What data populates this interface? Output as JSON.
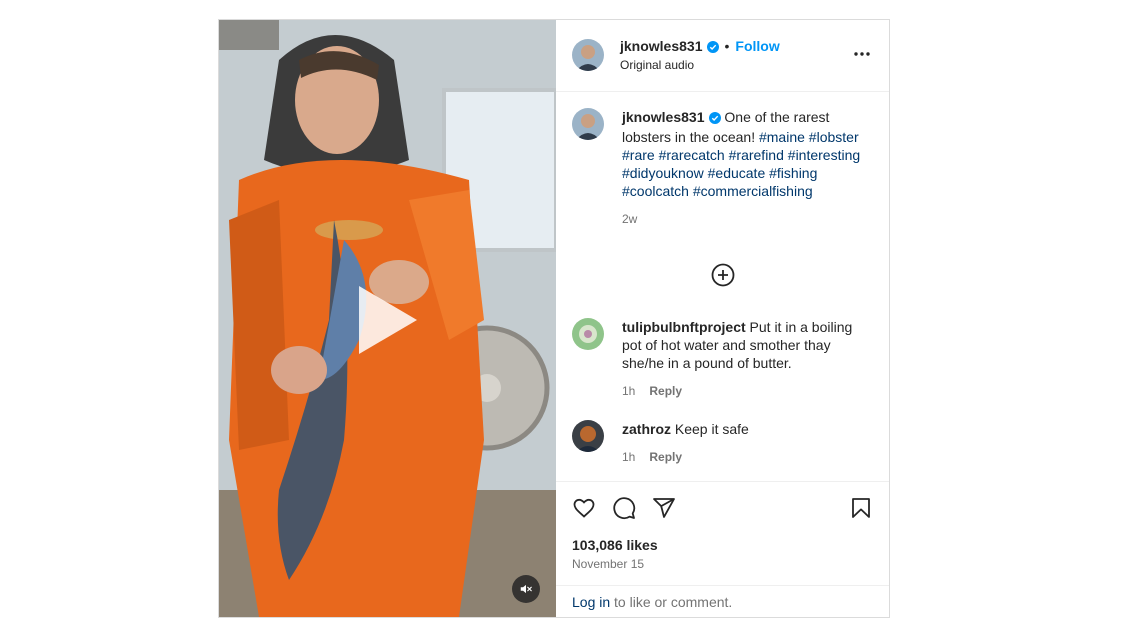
{
  "post": {
    "author": "jknowles831",
    "follow_label": "Follow",
    "separator": "•",
    "audio": "Original audio",
    "caption": {
      "text": "One of the rarest lobsters in the ocean!",
      "hashtags": [
        "#maine",
        "#lobster",
        "#rare",
        "#rarecatch",
        "#rarefind",
        "#interesting",
        "#didyouknow",
        "#educate",
        "#fishing",
        "#coolcatch",
        "#commercialfishing"
      ],
      "time": "2w"
    },
    "comments": [
      {
        "user": "tulipbulbnftproject",
        "text": "Put it in a boiling pot of hot water and smother thay she/he in a pound of butter.",
        "time": "1h",
        "reply_label": "Reply"
      },
      {
        "user": "zathroz",
        "text": "Keep it safe",
        "time": "1h",
        "reply_label": "Reply"
      }
    ],
    "likes": "103,086 likes",
    "date": "November 15",
    "login_link": "Log in",
    "login_text": " to like or comment."
  },
  "colors": {
    "accent": "#0095f6",
    "hashtag": "#00376b",
    "jacket": "#e8681d"
  },
  "icons": [
    "verified-badge-icon",
    "more-options-icon",
    "add-comment-icon",
    "heart-icon",
    "comment-icon",
    "share-icon",
    "save-icon",
    "play-icon",
    "muted-icon"
  ]
}
